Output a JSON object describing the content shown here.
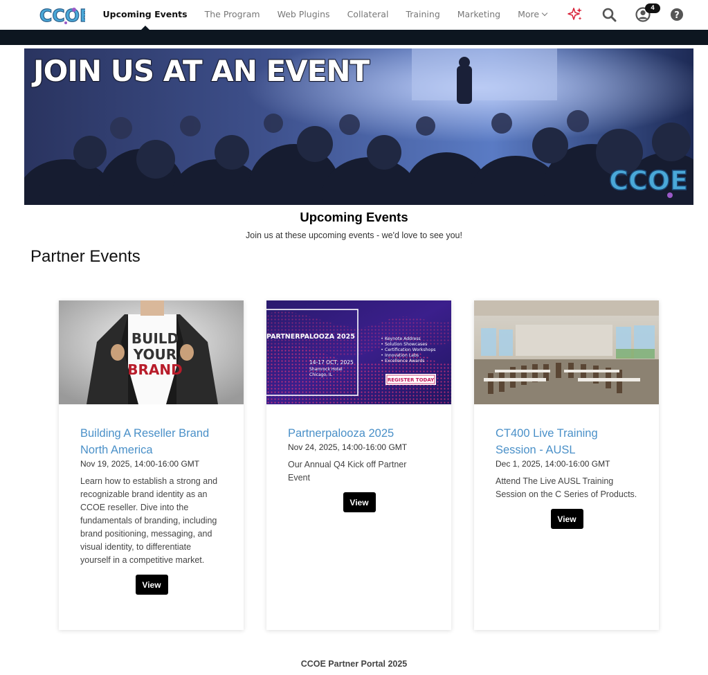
{
  "nav": {
    "items": [
      {
        "label": "Upcoming Events",
        "active": true
      },
      {
        "label": "The Program",
        "active": false
      },
      {
        "label": "Web Plugins",
        "active": false
      },
      {
        "label": "Collateral",
        "active": false
      },
      {
        "label": "Training",
        "active": false
      },
      {
        "label": "Marketing",
        "active": false
      }
    ],
    "more_label": "More",
    "notification_count": "4",
    "icons": [
      "ai-sparkle-icon",
      "search-icon",
      "user-account-icon",
      "help-icon"
    ]
  },
  "hero": {
    "headline": "JOIN US AT AN EVENT",
    "logo_text": "CCOE"
  },
  "page": {
    "title": "Upcoming Events",
    "subtitle": "Join us at these upcoming events - we'd love to see you!",
    "section_title": "Partner Events"
  },
  "events": [
    {
      "title": "Building A Reseller Brand North America",
      "date": "Nov 19, 2025, 14:00-16:00 GMT",
      "description": "Learn how to establish a strong and recognizable brand identity as an CCOE reseller. Dive into the fundamentals of branding, including brand positioning, messaging, and visual identity, to differentiate yourself in a competitive market.",
      "button": "View",
      "image_text": [
        "BUILD",
        "YOUR",
        "BRAND"
      ]
    },
    {
      "title": "Partnerpalooza 2025",
      "date": "Nov 24, 2025, 14:00-16:00 GMT",
      "description": "Our Annual Q4 Kick off Partner Event",
      "button": "View",
      "image_text": {
        "headline": "PARTNERPALOOZA 2025",
        "dates": "14-17 OCT, 2025",
        "venue": "Shamrock Hotel",
        "city": "Chicago, IL",
        "agenda": [
          "Keynote Address",
          "Solution Showcases",
          "Certification Workshops",
          "Innovation Labs",
          "Excellence Awards"
        ],
        "cta": "REGISTER TODAY"
      }
    },
    {
      "title": "CT400 Live Training Session - AUSL",
      "date": "Dec 1, 2025, 14:00-16:00 GMT",
      "description": "Attend The Live AUSL Training Session on the C Series of Products.",
      "button": "View"
    }
  ],
  "footer": {
    "text": "CCOE Partner Portal 2025"
  },
  "colors": {
    "dark_bar": "#0d1620",
    "link_blue": "#4a90c8",
    "logo_blue": "#4aa8d8",
    "sparkle_red": "#d9243a",
    "button_black": "#000000"
  }
}
